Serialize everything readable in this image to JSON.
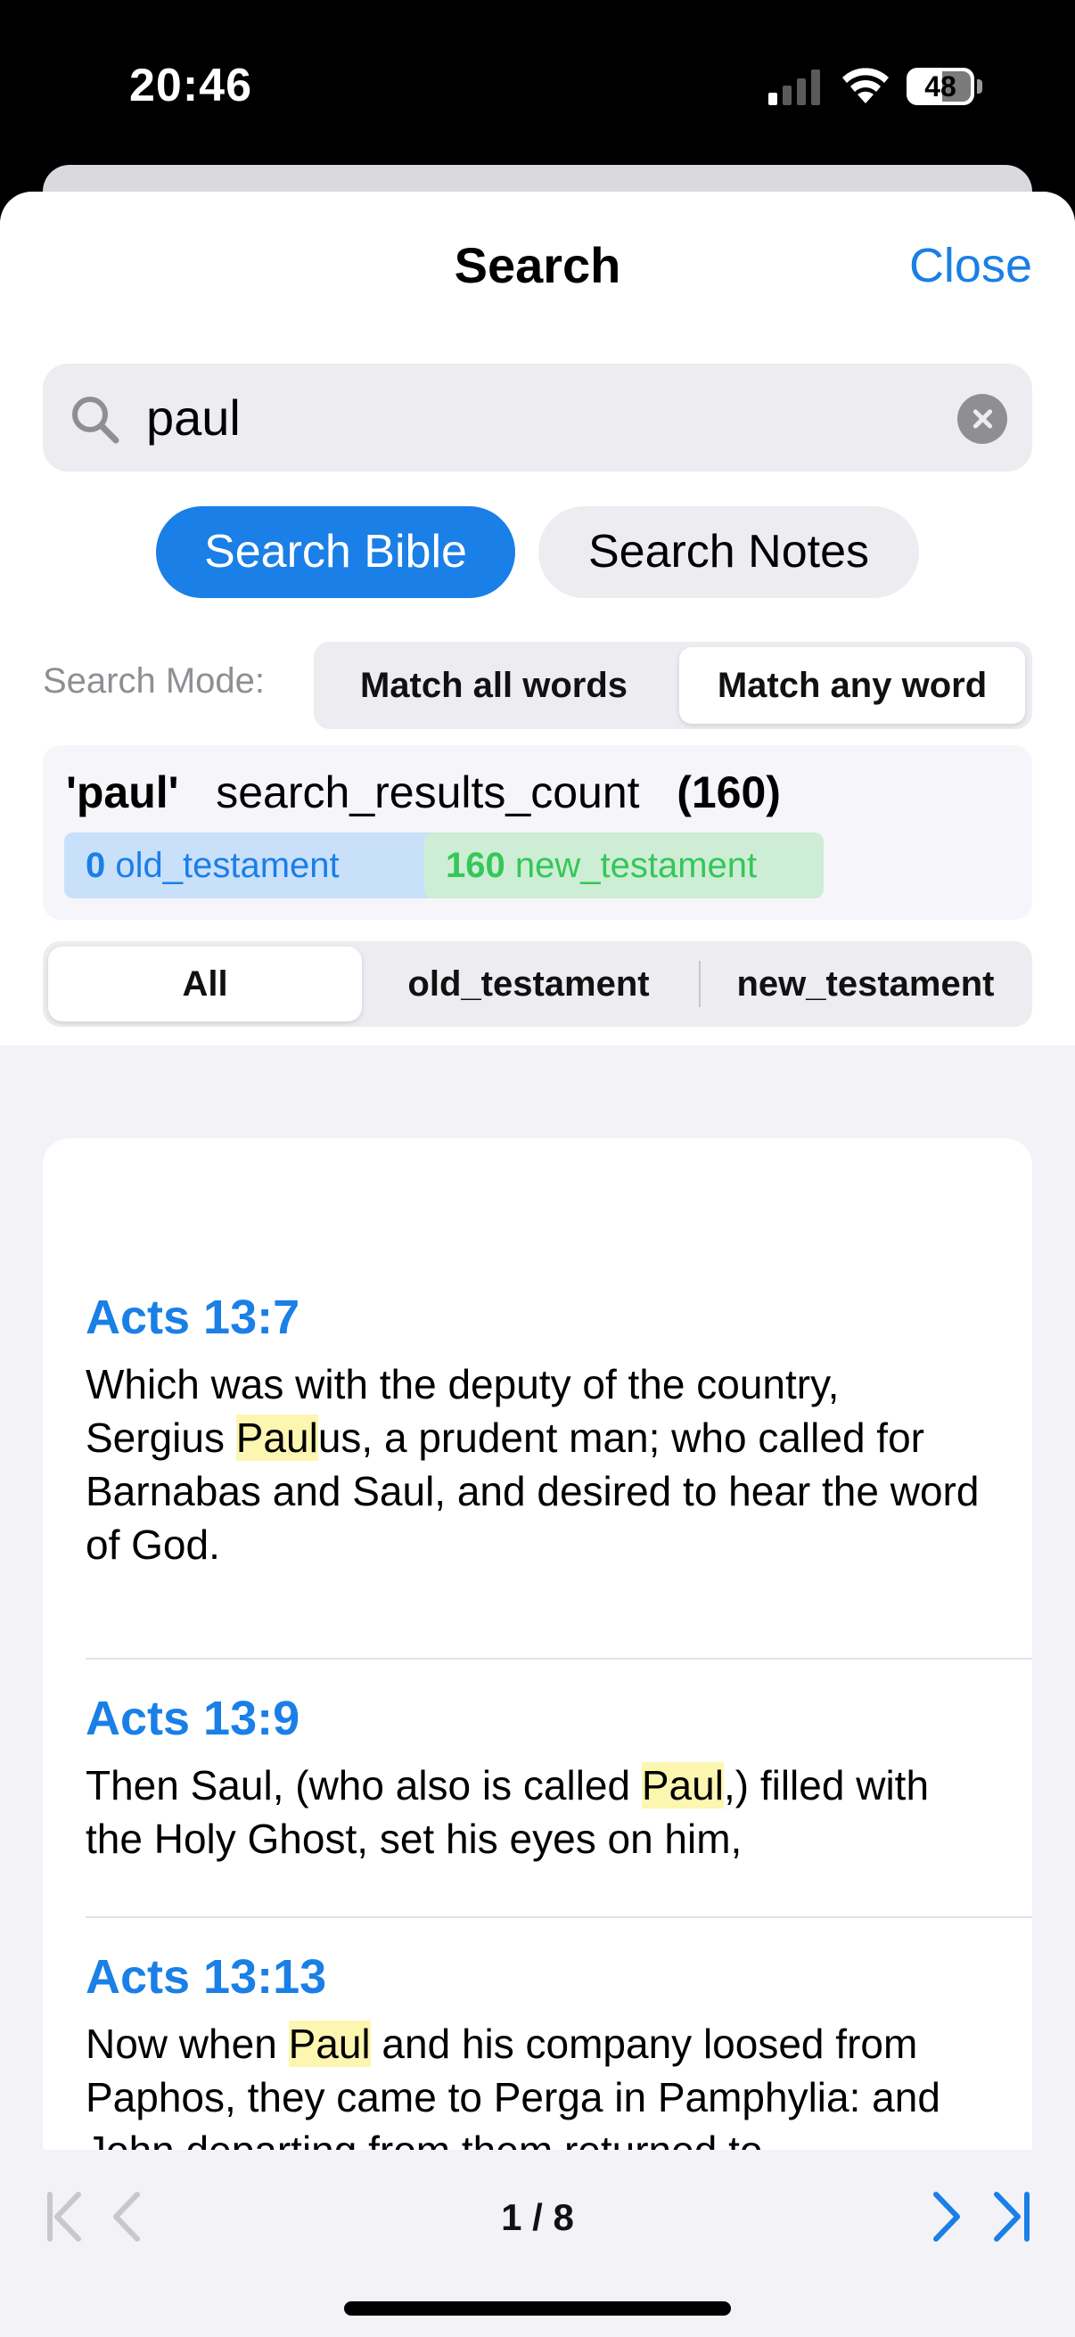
{
  "status_bar": {
    "time": "20:46",
    "battery": "48"
  },
  "header": {
    "title": "Search",
    "close_label": "Close"
  },
  "search": {
    "query": "paul"
  },
  "scope_buttons": {
    "bible_label": "Search Bible",
    "notes_label": "Search Notes",
    "active": "bible"
  },
  "search_mode": {
    "label": "Search Mode:",
    "options": [
      "Match all words",
      "Match any word"
    ],
    "selected": "Match any word"
  },
  "summary": {
    "query": "'paul'",
    "count_label": "search_results_count",
    "count": "(160)",
    "old_count": "0",
    "old_label": "old_testament",
    "new_count": "160",
    "new_label": "new_testament"
  },
  "filter": {
    "options": [
      "All",
      "old_testament",
      "new_testament"
    ],
    "selected": "All"
  },
  "results": [
    {
      "reference": "Acts 13:7",
      "text_parts": [
        "Which was with the deputy of the country, Sergius ",
        "Paul",
        "us, a prudent man; who called for Barnabas and Saul, and desired to hear the word of God."
      ]
    },
    {
      "reference": "Acts 13:9",
      "text_parts": [
        "Then Saul, (who also is called ",
        "Paul",
        ",) filled with the Holy Ghost, set his eyes on him,"
      ]
    },
    {
      "reference": "Acts 13:13",
      "text_parts": [
        "Now when ",
        "Paul",
        " and his company loosed from Paphos, they came to Perga in Pamphylia: and John departing from them returned to"
      ]
    }
  ],
  "pager": {
    "indicator": "1 / 8"
  },
  "colors": {
    "accent": "#1a7fe6",
    "green": "#34c759",
    "highlight": "#fdf6b1"
  }
}
